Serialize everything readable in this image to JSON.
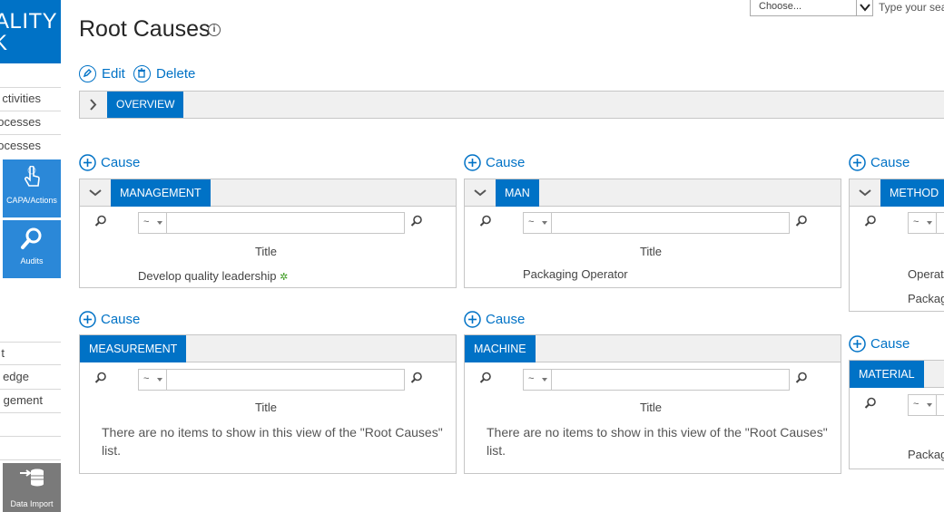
{
  "brand": {
    "line1": "ALITY",
    "line2": "K"
  },
  "nav": {
    "items_top": [
      "ctivities",
      "ocesses",
      "ocesses"
    ],
    "tiles": [
      {
        "label": "CAPA/Actions",
        "icon": "hand-pointer-icon"
      },
      {
        "label": "Audits",
        "icon": "magnifier-icon"
      }
    ],
    "items_bottom": [
      "t",
      "edge",
      "gement"
    ],
    "data_import": {
      "label": "Data Import",
      "icon": "database-import-icon"
    }
  },
  "topbar": {
    "choose_label": "Choose...",
    "search_placeholder": "Type your sea"
  },
  "page": {
    "title": "Root Causes"
  },
  "actions": {
    "edit": "Edit",
    "delete": "Delete"
  },
  "overview_tab": "OVERVIEW",
  "add_cause_label": "Cause",
  "filter_operator": "~",
  "panels": [
    {
      "category": "MANAGEMENT",
      "column": "Title",
      "items": [
        "Develop quality leadership"
      ],
      "empty": ""
    },
    {
      "category": "MAN",
      "column": "Title",
      "items": [
        "Packaging Operator"
      ],
      "empty": ""
    },
    {
      "category": "METHOD",
      "column": "",
      "items": [
        "Operat",
        "Packag"
      ],
      "empty": ""
    },
    {
      "category": "MEASUREMENT",
      "column": "Title",
      "items": [],
      "empty": "There are no items to show in this view of the \"Root Causes\" list."
    },
    {
      "category": "MACHINE",
      "column": "Title",
      "items": [],
      "empty": "There are no items to show in this view of the \"Root Causes\" list."
    },
    {
      "category": "MATERIAL",
      "column": "",
      "items": [
        "Packag"
      ],
      "empty": ""
    }
  ],
  "colors": {
    "accent": "#0072c6",
    "tile": "#2b88d8",
    "new_badge": "#3b9a1f"
  }
}
